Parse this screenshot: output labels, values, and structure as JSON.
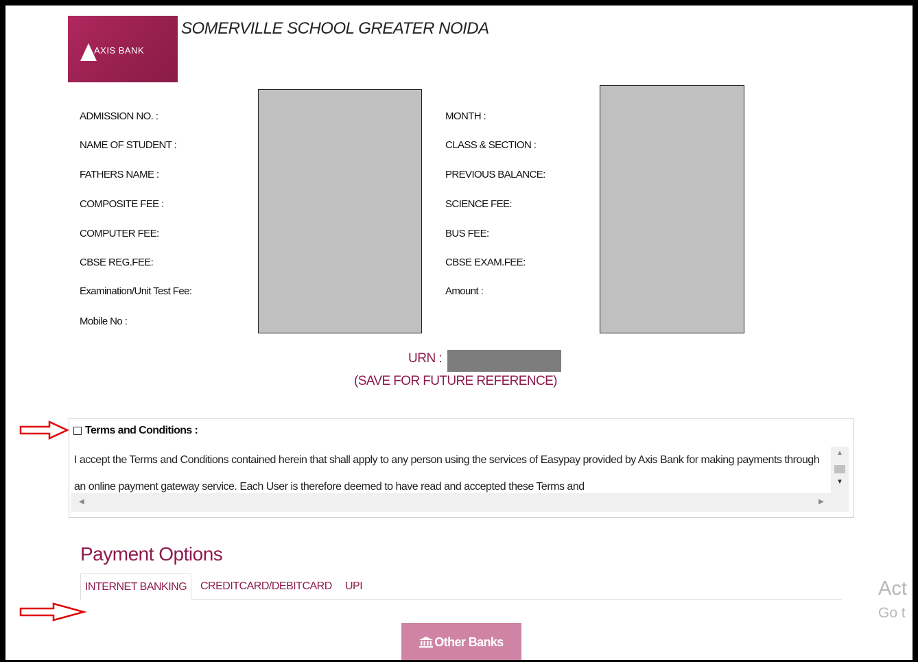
{
  "header": {
    "logo_text": "AXIS BANK",
    "school_name": "SOMERVILLE SCHOOL GREATER NOIDA"
  },
  "fields_left": [
    "ADMISSION NO. :",
    "NAME OF STUDENT :",
    "FATHERS NAME :",
    "COMPOSITE FEE :",
    "COMPUTER FEE:",
    "CBSE REG.FEE:",
    "Examination/Unit Test Fee:",
    "Mobile No :"
  ],
  "fields_right": [
    "MONTH :",
    "CLASS & SECTION :",
    "PREVIOUS BALANCE:",
    "SCIENCE FEE:",
    "BUS FEE:",
    "CBSE EXAM.FEE:",
    "Amount :"
  ],
  "urn": {
    "label": "URN :",
    "note": "(SAVE FOR FUTURE REFERENCE)"
  },
  "terms": {
    "heading": "Terms and Conditions :",
    "checked": false,
    "text": "I accept the Terms and Conditions contained herein that shall apply to any person using the services of Easypay provided by Axis Bank for making payments through an online payment gateway service. Each User is therefore deemed to have read and accepted these Terms and"
  },
  "payment": {
    "title": "Payment Options",
    "tabs": [
      "INTERNET BANKING",
      "CREDITCARD/DEBITCARD",
      "UPI"
    ],
    "active_tab": "INTERNET BANKING",
    "button_label": "Other Banks"
  },
  "watermark": {
    "line1": "Act",
    "line2": "Go t"
  },
  "colors": {
    "accent": "#8e1b4d",
    "logo_bg": "#a0245a",
    "button_bg": "#cf84a5",
    "arrow": "#e00000"
  }
}
